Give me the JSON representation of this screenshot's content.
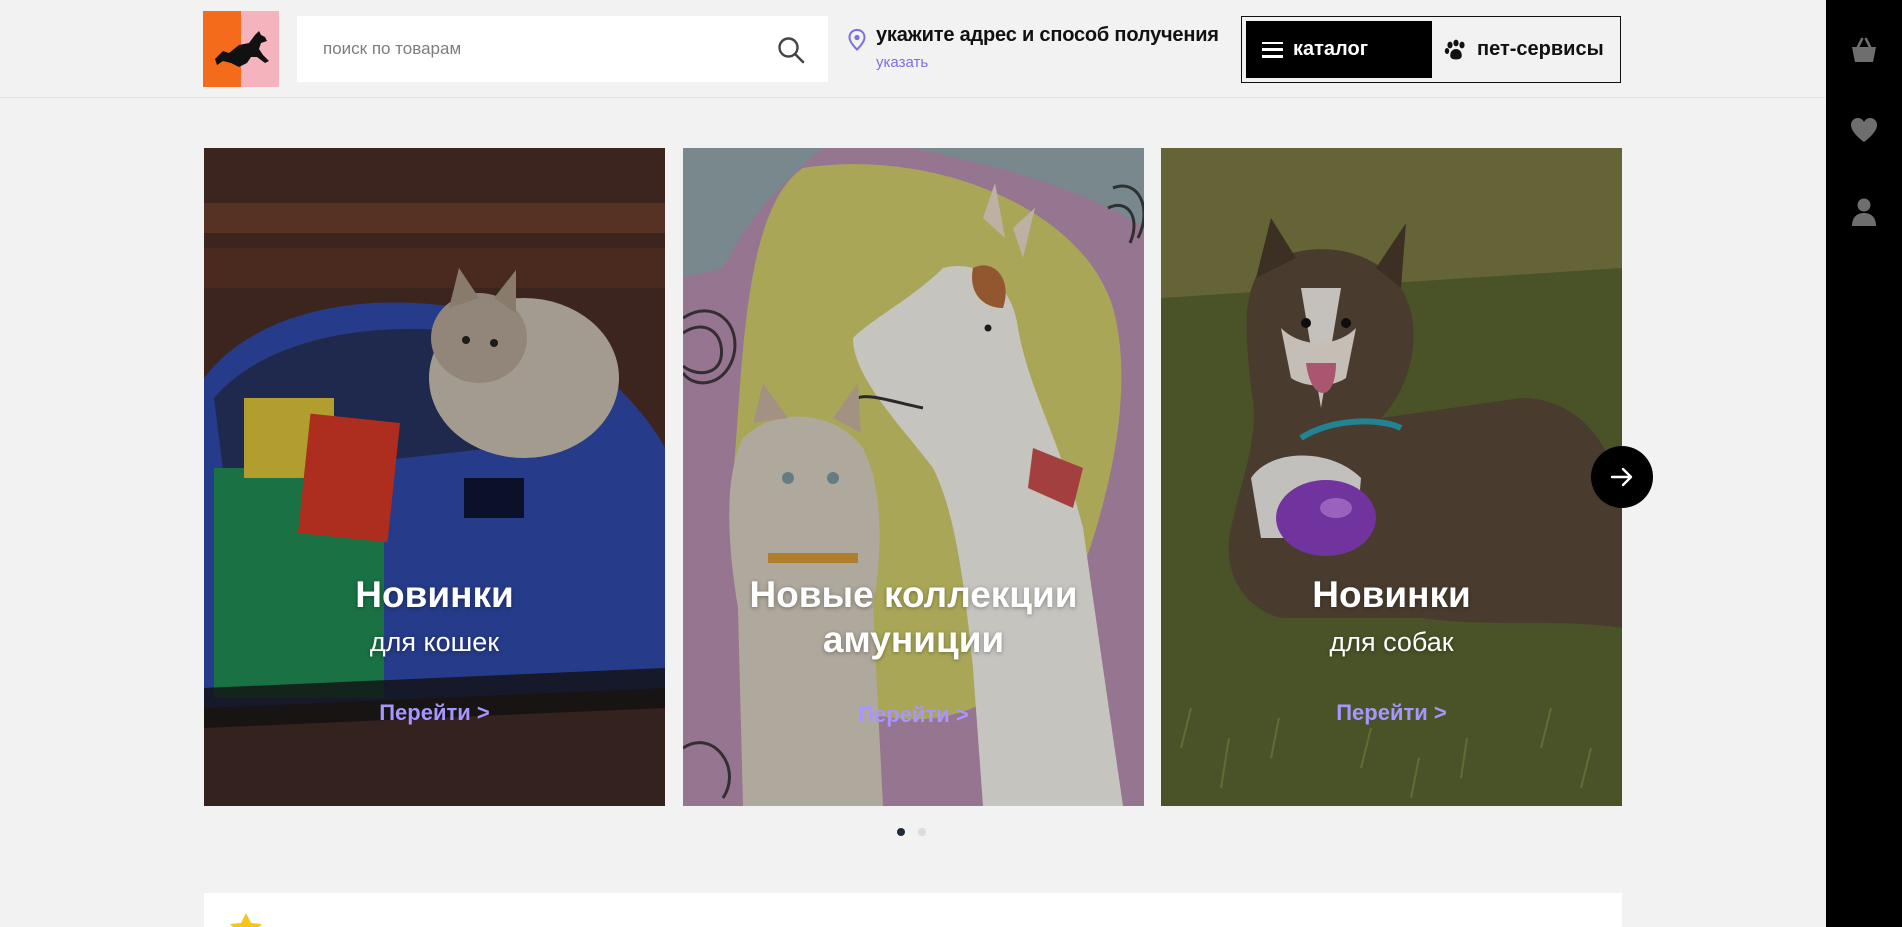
{
  "header": {
    "search_placeholder": "поиск по товарам",
    "address_title": "укажите адрес и способ получения",
    "address_link": "указать",
    "catalog_label": "каталог",
    "services_label": "пет-сервисы"
  },
  "colors": {
    "logo_orange": "#f46b1c",
    "logo_pink": "#f5b4bd",
    "accent_link": "#7b6fe0",
    "card_link": "#a796ff"
  },
  "sidebar": {
    "items": [
      {
        "icon": "basket-icon"
      },
      {
        "icon": "heart-icon"
      },
      {
        "icon": "user-icon"
      }
    ]
  },
  "cards": [
    {
      "title": "Новинки",
      "subtitle": "для кошек",
      "link": "Перейти >"
    },
    {
      "title": "Новые коллекции амуниции",
      "subtitle": "",
      "link": "Перейти >"
    },
    {
      "title": "Новинки",
      "subtitle": "для собак",
      "link": "Перейти >"
    }
  ],
  "carousel": {
    "page_count": 2,
    "active_page": 1
  }
}
